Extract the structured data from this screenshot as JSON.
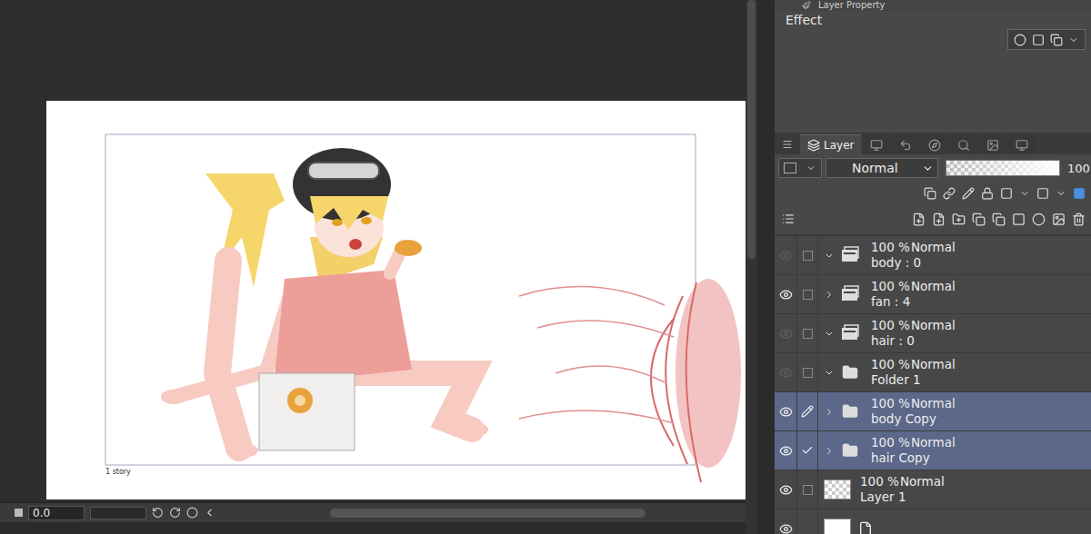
{
  "canvas": {
    "caption": "1 story"
  },
  "timeline": {
    "frame": "0.0"
  },
  "property_panel": {
    "title": "Layer Property",
    "section": "Effect"
  },
  "layer_panel": {
    "tabs": [
      {
        "label": "Layer",
        "selected": true
      },
      {
        "selected": false
      },
      {
        "selected": false
      },
      {
        "selected": false
      },
      {
        "selected": false
      },
      {
        "selected": false
      },
      {
        "selected": false
      }
    ],
    "blend_mode": "Normal",
    "opacity": "100",
    "opacity_level": 1,
    "layers": [
      {
        "kind": "animation-folder",
        "visible": false,
        "marker": "box",
        "expanded": true,
        "opacity": "100 %",
        "blend": "Normal",
        "name": "body : 0",
        "selected": false
      },
      {
        "kind": "animation-folder",
        "visible": true,
        "marker": "box",
        "expanded": false,
        "opacity": "100 %",
        "blend": "Normal",
        "name": "fan : 4",
        "selected": false
      },
      {
        "kind": "animation-folder",
        "visible": false,
        "marker": "box",
        "expanded": true,
        "opacity": "100 %",
        "blend": "Normal",
        "name": "hair : 0",
        "selected": false
      },
      {
        "kind": "folder",
        "visible": false,
        "marker": "box",
        "expanded": true,
        "opacity": "100 %",
        "blend": "Normal",
        "name": "Folder 1",
        "selected": false
      },
      {
        "kind": "folder",
        "visible": true,
        "marker": "pen",
        "expanded": false,
        "opacity": "100 %",
        "blend": "Normal",
        "name": "body Copy",
        "selected": true
      },
      {
        "kind": "folder",
        "visible": true,
        "marker": "check",
        "expanded": false,
        "opacity": "100 %",
        "blend": "Normal",
        "name": "hair Copy",
        "selected": true
      },
      {
        "kind": "raster",
        "visible": true,
        "marker": "box",
        "expanded": null,
        "opacity": "100 %",
        "blend": "Normal",
        "name": "Layer 1",
        "selected": false
      },
      {
        "kind": "paper",
        "visible": true,
        "marker": "none",
        "expanded": null,
        "selected": false
      }
    ]
  }
}
